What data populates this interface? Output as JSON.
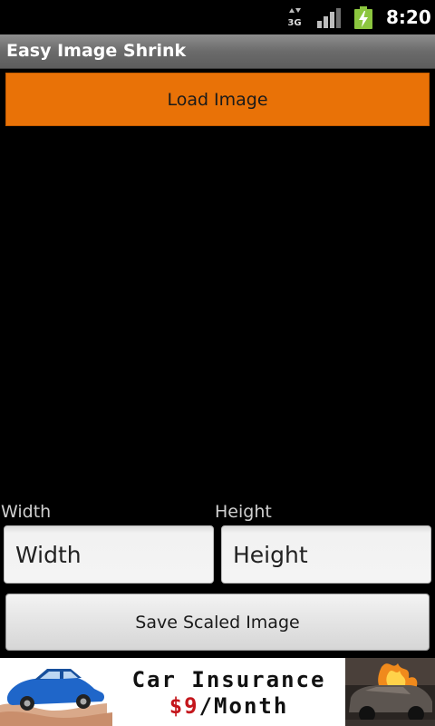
{
  "status_bar": {
    "network_type": "3G",
    "time": "8:20",
    "icons": [
      "data-transfer-3g-icon",
      "signal-strength-icon",
      "battery-charging-icon"
    ],
    "battery_color": "#8cc63f"
  },
  "app": {
    "title": "Easy Image Shrink"
  },
  "load_button": {
    "label": "Load Image",
    "color": "#e97207"
  },
  "dimensions": {
    "width_label": "Width",
    "height_label": "Height",
    "width_placeholder": "Width",
    "height_placeholder": "Height",
    "width_value": "",
    "height_value": ""
  },
  "save_button": {
    "label": "Save Scaled Image"
  },
  "ad": {
    "line1": "Car Insurance",
    "price": "$9",
    "price_suffix": "/Month",
    "price_color": "#c4161c",
    "left_image": "blue-car-in-hands-image",
    "right_image": "burning-car-image"
  }
}
